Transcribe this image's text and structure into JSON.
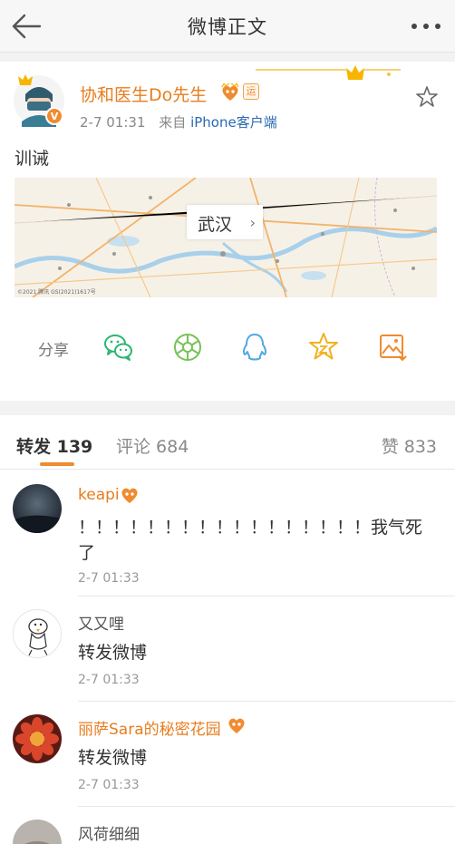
{
  "header": {
    "title": "微博正文"
  },
  "post": {
    "author": "协和医生Do先生",
    "level_badge": "运",
    "time": "2-7 01:31",
    "source_prefix": "来自",
    "source": "iPhone客户端",
    "text": "训诫",
    "location": "武汉",
    "map_copyright": "©2021 腾讯 GS(2021)1617号"
  },
  "share": {
    "label": "分享"
  },
  "tabs": [
    {
      "label": "转发 139"
    },
    {
      "label": "评论 684"
    },
    {
      "label": "赞 833"
    }
  ],
  "reposts": [
    {
      "name": "keapi",
      "text": "！！！！！！！！！！！！！！！！！我气死了",
      "time": "2-7 01:33"
    },
    {
      "name": "又又哩",
      "text": "转发微博",
      "time": "2-7 01:33"
    },
    {
      "name": "丽萨Sara的秘密花园",
      "text": "转发微博",
      "time": "2-7 01:33"
    },
    {
      "name": "风荷细细"
    }
  ],
  "colors": {
    "accent": "#f08b2f",
    "name_orange": "#e87d1e",
    "link_blue": "#2a69b1",
    "wechat_green": "#2bb673"
  }
}
